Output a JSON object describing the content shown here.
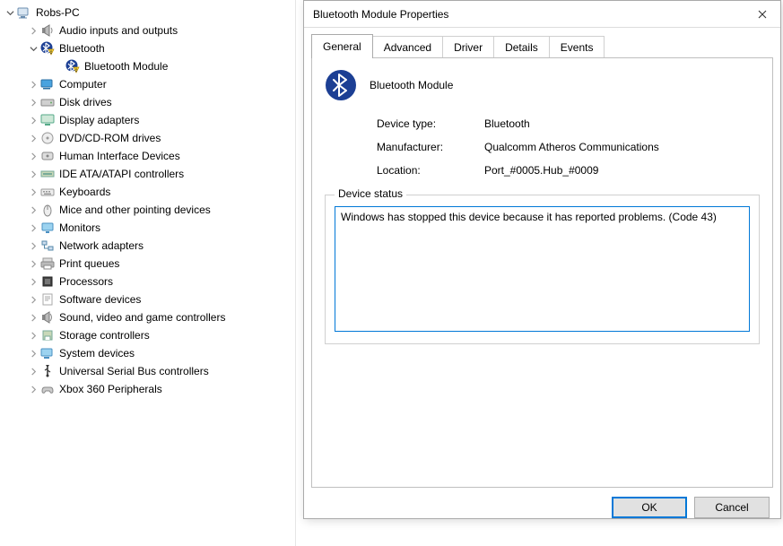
{
  "tree": {
    "root": {
      "label": "Robs-PC",
      "icon": "pc-icon",
      "expanded": true
    },
    "items": [
      {
        "label": "Audio inputs and outputs",
        "icon": "speaker-icon",
        "expanded": false,
        "hasChildren": true
      },
      {
        "label": "Bluetooth",
        "icon": "bluetooth-warn-icon",
        "expanded": true,
        "hasChildren": true,
        "children": [
          {
            "label": "Bluetooth Module",
            "icon": "bluetooth-warn-icon"
          }
        ]
      },
      {
        "label": "Computer",
        "icon": "computer-icon",
        "expanded": false,
        "hasChildren": true
      },
      {
        "label": "Disk drives",
        "icon": "diskdrive-icon",
        "expanded": false,
        "hasChildren": true
      },
      {
        "label": "Display adapters",
        "icon": "display-icon",
        "expanded": false,
        "hasChildren": true
      },
      {
        "label": "DVD/CD-ROM drives",
        "icon": "dvd-icon",
        "expanded": false,
        "hasChildren": true
      },
      {
        "label": "Human Interface Devices",
        "icon": "hid-icon",
        "expanded": false,
        "hasChildren": true
      },
      {
        "label": "IDE ATA/ATAPI controllers",
        "icon": "ide-icon",
        "expanded": false,
        "hasChildren": true
      },
      {
        "label": "Keyboards",
        "icon": "keyboard-icon",
        "expanded": false,
        "hasChildren": true
      },
      {
        "label": "Mice and other pointing devices",
        "icon": "mouse-icon",
        "expanded": false,
        "hasChildren": true
      },
      {
        "label": "Monitors",
        "icon": "monitor-icon",
        "expanded": false,
        "hasChildren": true
      },
      {
        "label": "Network adapters",
        "icon": "network-icon",
        "expanded": false,
        "hasChildren": true
      },
      {
        "label": "Print queues",
        "icon": "printer-icon",
        "expanded": false,
        "hasChildren": true
      },
      {
        "label": "Processors",
        "icon": "cpu-icon",
        "expanded": false,
        "hasChildren": true
      },
      {
        "label": "Software devices",
        "icon": "software-icon",
        "expanded": false,
        "hasChildren": true
      },
      {
        "label": "Sound, video and game controllers",
        "icon": "sound-icon",
        "expanded": false,
        "hasChildren": true
      },
      {
        "label": "Storage controllers",
        "icon": "storage-icon",
        "expanded": false,
        "hasChildren": true
      },
      {
        "label": "System devices",
        "icon": "system-icon",
        "expanded": false,
        "hasChildren": true
      },
      {
        "label": "Universal Serial Bus controllers",
        "icon": "usb-icon",
        "expanded": false,
        "hasChildren": true
      },
      {
        "label": "Xbox 360 Peripherals",
        "icon": "xbox-icon",
        "expanded": false,
        "hasChildren": true
      }
    ]
  },
  "dialog": {
    "title": "Bluetooth Module Properties",
    "tabs": [
      "General",
      "Advanced",
      "Driver",
      "Details",
      "Events"
    ],
    "activeTab": "General",
    "general": {
      "deviceName": "Bluetooth Module",
      "rows": {
        "typeLabel": "Device type:",
        "typeValue": "Bluetooth",
        "mfgLabel": "Manufacturer:",
        "mfgValue": "Qualcomm Atheros Communications",
        "locLabel": "Location:",
        "locValue": "Port_#0005.Hub_#0009"
      },
      "statusLegend": "Device status",
      "statusText": "Windows has stopped this device because it has reported problems. (Code 43)"
    },
    "buttons": {
      "ok": "OK",
      "cancel": "Cancel"
    }
  }
}
